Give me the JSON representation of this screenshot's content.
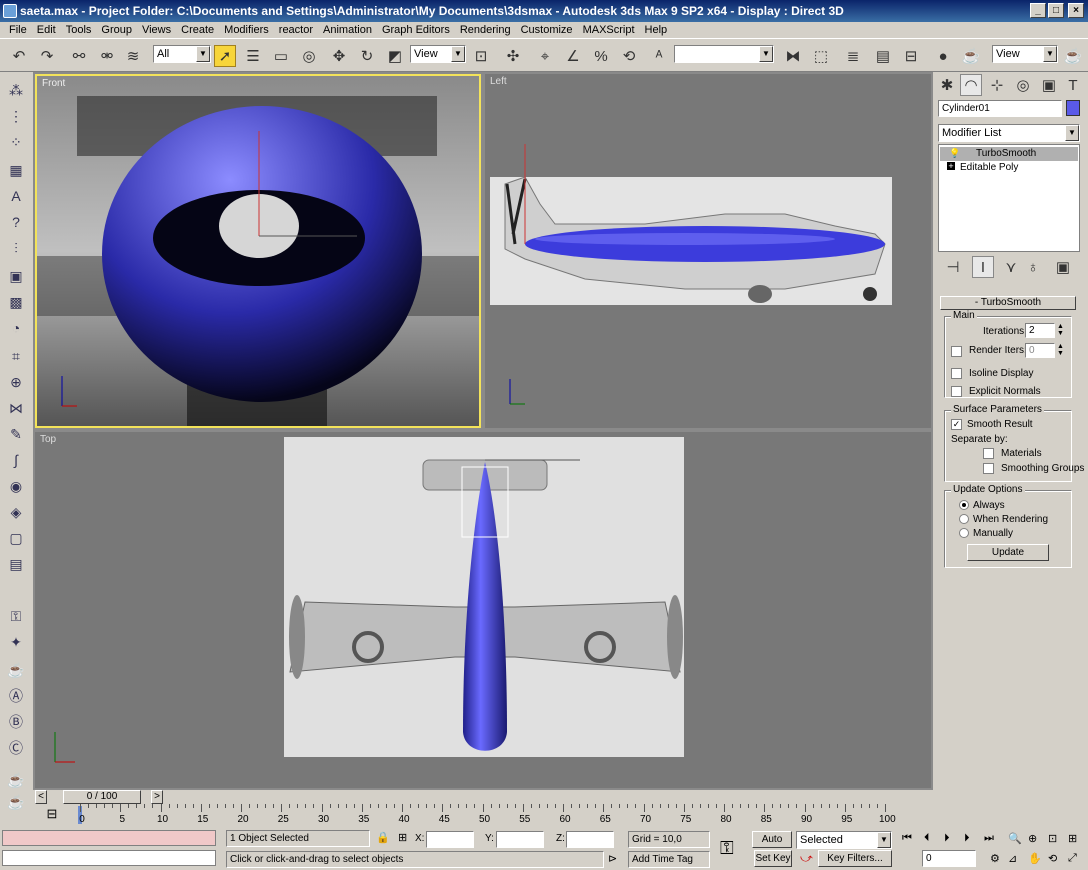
{
  "window": {
    "title": "saeta.max     - Project Folder: C:\\Documents and Settings\\Administrator\\My Documents\\3dsmax     - Autodesk 3ds Max 9 SP2 x64     - Display : Direct 3D"
  },
  "menu": [
    "File",
    "Edit",
    "Tools",
    "Group",
    "Views",
    "Create",
    "Modifiers",
    "reactor",
    "Animation",
    "Graph Editors",
    "Rendering",
    "Customize",
    "MAXScript",
    "Help"
  ],
  "toolbar": {
    "selection_filter": "All",
    "ref_coord": "View",
    "named_sel": "",
    "render_view": "View"
  },
  "viewports": {
    "front": "Front",
    "left": "Left",
    "top": "Top"
  },
  "command_panel": {
    "object_name": "Cylinder01",
    "object_color": "#5a5ae8",
    "modifier_list": "Modifier List",
    "stack": [
      "TurboSmooth",
      "Editable Poly"
    ],
    "rollout_title": "TurboSmooth",
    "main": {
      "title": "Main",
      "iterations_label": "Iterations:",
      "iterations": "2",
      "render_iters_label": "Render Iters:",
      "render_iters": "0",
      "isoline": "Isoline Display",
      "explicit": "Explicit Normals"
    },
    "surface": {
      "title": "Surface Parameters",
      "smooth_result": "Smooth Result",
      "separate_by": "Separate by:",
      "materials": "Materials",
      "smoothing_groups": "Smoothing Groups"
    },
    "update": {
      "title": "Update Options",
      "always": "Always",
      "when_rendering": "When Rendering",
      "manually": "Manually",
      "button": "Update"
    }
  },
  "timeline": {
    "frame": "0 / 100",
    "ticks": [
      "0",
      "5",
      "10",
      "15",
      "20",
      "25",
      "30",
      "35",
      "40",
      "45",
      "50",
      "55",
      "60",
      "65",
      "70",
      "75",
      "80",
      "85",
      "90",
      "95",
      "100"
    ]
  },
  "status": {
    "selected": "1 Object Selected",
    "prompt": "Click or click-and-drag to select objects",
    "x_label": "X:",
    "y_label": "Y:",
    "z_label": "Z:",
    "grid": "Grid = 10,0",
    "add_time_tag": "Add Time Tag",
    "auto_key": "Auto Key",
    "set_key": "Set Key",
    "key_mode": "Selected",
    "key_filters": "Key Filters...",
    "frame_field": "0"
  }
}
